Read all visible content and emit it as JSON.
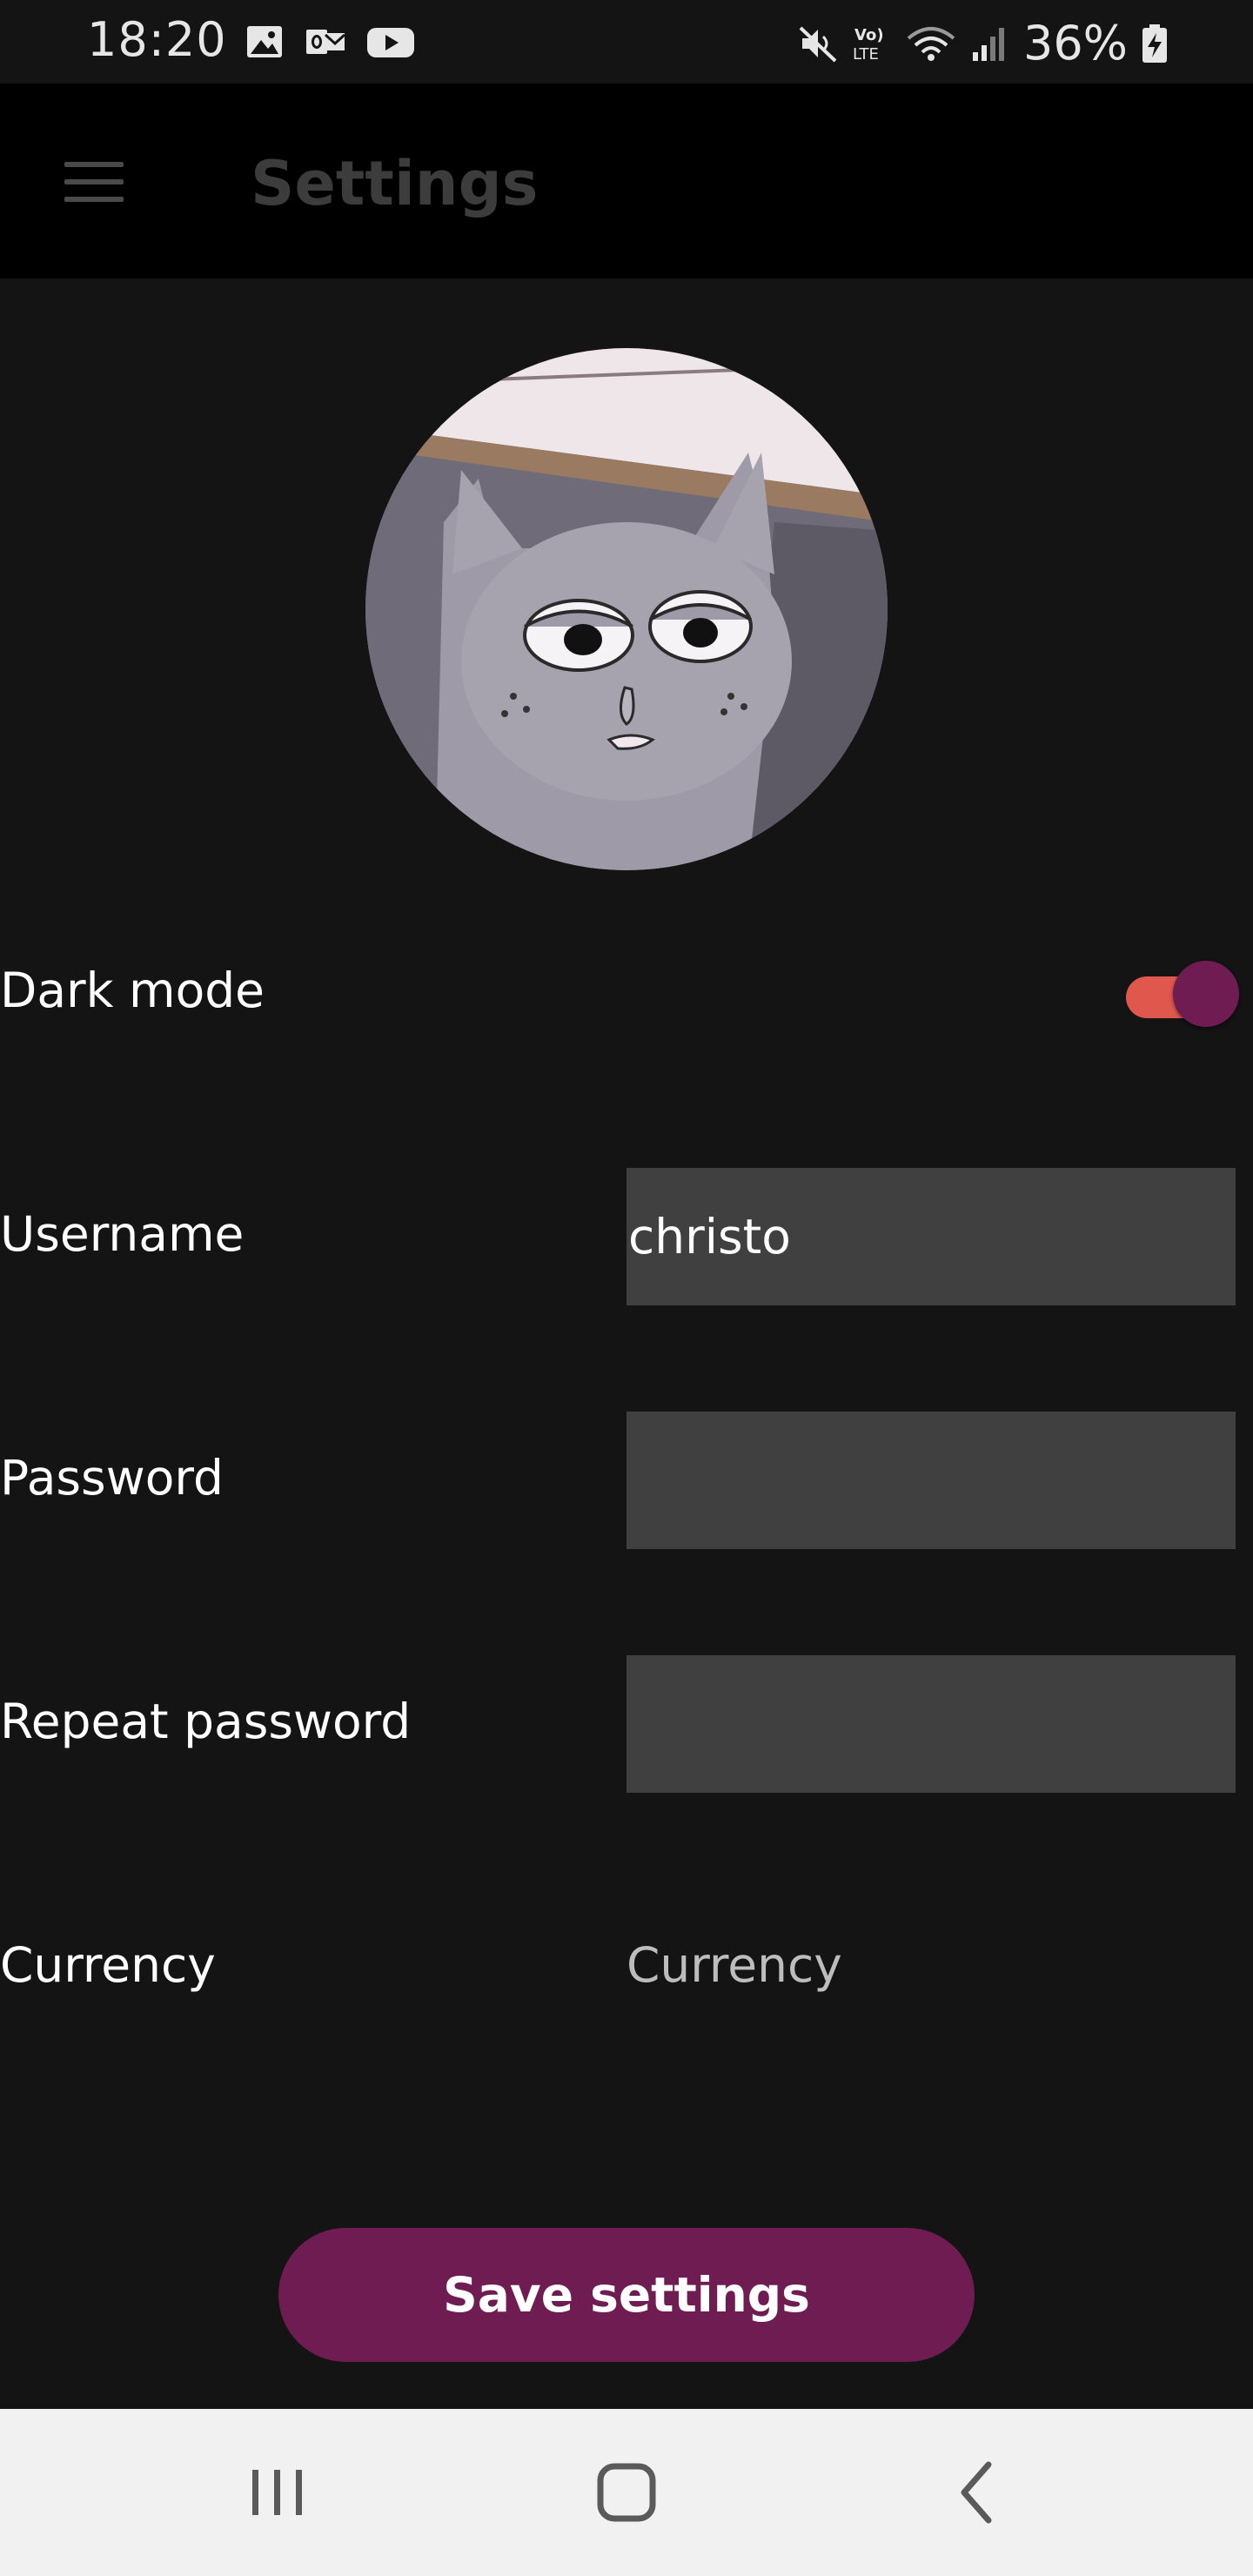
{
  "status_bar": {
    "time": "18:20",
    "battery": "36%",
    "icons_left": [
      "image-icon",
      "outlook-icon",
      "youtube-icon"
    ],
    "icons_right": [
      "mute-icon",
      "volte-icon",
      "wifi-icon",
      "signal-icon",
      "battery-charging-icon"
    ]
  },
  "app_bar": {
    "title": "Settings"
  },
  "settings": {
    "dark_mode": {
      "label": "Dark mode",
      "enabled": true
    },
    "username": {
      "label": "Username",
      "value": "christo"
    },
    "password": {
      "label": "Password",
      "value": ""
    },
    "repeat_password": {
      "label": "Repeat password",
      "value": ""
    },
    "currency": {
      "label": "Currency",
      "placeholder": "Currency"
    }
  },
  "actions": {
    "save_label": "Save settings"
  },
  "colors": {
    "background": "#141414",
    "app_bar": "#000000",
    "accent": "#6e1c52",
    "toggle_track": "#e0574e",
    "field_bg": "#404040"
  }
}
